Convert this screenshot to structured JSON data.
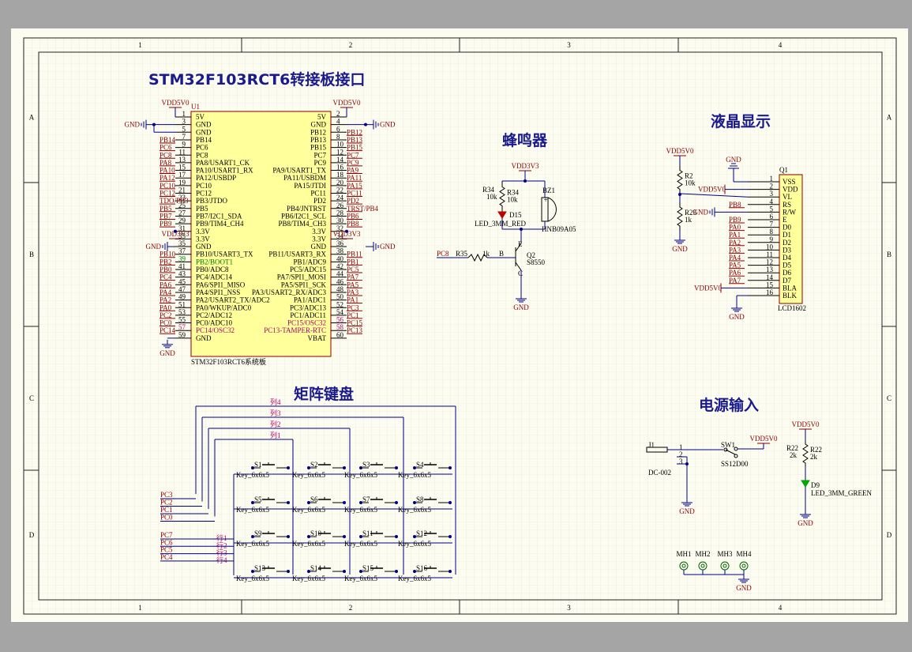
{
  "titles": {
    "mcu": "STM32F103RCT6转接板接口",
    "buzzer": "蜂鸣器",
    "lcd": "液晶显示",
    "keypad": "矩阵键盘",
    "power": "电源输入"
  },
  "zones": {
    "cols": [
      "1",
      "2",
      "3",
      "4"
    ],
    "rows": [
      "A",
      "B",
      "C",
      "D"
    ]
  },
  "mcu": {
    "ref": "U1",
    "footer": "STM32F103RCT6系统板",
    "left_pins": [
      {
        "num": "1",
        "name": "5V",
        "net": ""
      },
      {
        "num": "3",
        "name": "GND",
        "net": ""
      },
      {
        "num": "5",
        "name": "GND",
        "net": ""
      },
      {
        "num": "7",
        "name": "PB14",
        "net": "PB14"
      },
      {
        "num": "9",
        "name": "PC6",
        "net": "PC6"
      },
      {
        "num": "11",
        "name": "PC8",
        "net": "PC8"
      },
      {
        "num": "13",
        "name": "PA8/USART1_CK",
        "net": "PA8"
      },
      {
        "num": "15",
        "name": "PA10/USART1_RX",
        "net": "PA10"
      },
      {
        "num": "17",
        "name": "PA12/USBDP",
        "net": "PA12"
      },
      {
        "num": "19",
        "name": "PC10",
        "net": "PC10"
      },
      {
        "num": "21",
        "name": "PC12",
        "net": "PC12"
      },
      {
        "num": "23",
        "name": "PB3/JTDO",
        "net": "TDO/PB3"
      },
      {
        "num": "25",
        "name": "PB5",
        "net": "PB5"
      },
      {
        "num": "27",
        "name": "PB7/I2C1_SDA",
        "net": "PB7"
      },
      {
        "num": "29",
        "name": "PB9/TIM4_CH4",
        "net": "PB9"
      },
      {
        "num": "31",
        "name": "3.3V",
        "net": ""
      },
      {
        "num": "33",
        "name": "3.3V",
        "net": ""
      },
      {
        "num": "35",
        "name": "GND",
        "net": ""
      },
      {
        "num": "37",
        "name": "PB10/USART3_TX",
        "net": "PB10"
      },
      {
        "num": "39",
        "name": "PB2/BOOT1",
        "net": "PB2"
      },
      {
        "num": "41",
        "name": "PB0/ADC8",
        "net": "PB0"
      },
      {
        "num": "43",
        "name": "PC4/ADC14",
        "net": "PC4"
      },
      {
        "num": "45",
        "name": "PA6/SPI1_MISO",
        "net": "PA6"
      },
      {
        "num": "47",
        "name": "PA4/SPI1_NSS",
        "net": "PA4"
      },
      {
        "num": "49",
        "name": "PA2/USART2_TX/ADC2",
        "net": "PA2"
      },
      {
        "num": "51",
        "name": "PA0/WKUP/ADC0",
        "net": "PA0"
      },
      {
        "num": "53",
        "name": "PC2/ADC12",
        "net": "PC2"
      },
      {
        "num": "55",
        "name": "PC0/ADC10",
        "net": "PC0"
      },
      {
        "num": "57",
        "name": "PC14/OSC32",
        "net": "PC14"
      },
      {
        "num": "59",
        "name": "GND",
        "net": ""
      }
    ],
    "right_pins": [
      {
        "num": "2",
        "name": "5V",
        "net": ""
      },
      {
        "num": "4",
        "name": "GND",
        "net": ""
      },
      {
        "num": "6",
        "name": "PB12",
        "net": "PB12"
      },
      {
        "num": "8",
        "name": "PB13",
        "net": "PB13"
      },
      {
        "num": "10",
        "name": "PB15",
        "net": "PB15"
      },
      {
        "num": "12",
        "name": "PC7",
        "net": "PC7"
      },
      {
        "num": "14",
        "name": "PC9",
        "net": "PC9"
      },
      {
        "num": "16",
        "name": "PA9/USART1_TX",
        "net": "PA9"
      },
      {
        "num": "18",
        "name": "PA11/USBDM",
        "net": "PA11"
      },
      {
        "num": "20",
        "name": "PA15/JTDI",
        "net": "PA15"
      },
      {
        "num": "22",
        "name": "PC11",
        "net": "PC11"
      },
      {
        "num": "24",
        "name": "PD2",
        "net": "PD2"
      },
      {
        "num": "26",
        "name": "PB4/JNTRST",
        "net": "TRST/PB4"
      },
      {
        "num": "28",
        "name": "PB6/I2C1_SCL",
        "net": "PB6"
      },
      {
        "num": "30",
        "name": "PB8/TIM4_CH3",
        "net": "PB8"
      },
      {
        "num": "32",
        "name": "3.3V",
        "net": ""
      },
      {
        "num": "34",
        "name": "3.3V",
        "net": ""
      },
      {
        "num": "36",
        "name": "GND",
        "net": ""
      },
      {
        "num": "38",
        "name": "PB11/USART3_RX",
        "net": "PB11"
      },
      {
        "num": "40",
        "name": "PB1/ADC9",
        "net": "PB1"
      },
      {
        "num": "42",
        "name": "PC5/ADC15",
        "net": "PC5"
      },
      {
        "num": "44",
        "name": "PA7/SPI1_MOSI",
        "net": "PA7"
      },
      {
        "num": "46",
        "name": "PA5/SPI1_SCK",
        "net": "PA5"
      },
      {
        "num": "48",
        "name": "PA3/USART2_RX/ADC3",
        "net": "PA3"
      },
      {
        "num": "50",
        "name": "PA1/ADC1",
        "net": "PA1"
      },
      {
        "num": "52",
        "name": "PC3/ADC13",
        "net": "PC3"
      },
      {
        "num": "54",
        "name": "PC1/ADC11",
        "net": "PC1"
      },
      {
        "num": "56",
        "name": "PC15/OSC32",
        "net": "PC15"
      },
      {
        "num": "58",
        "name": "PC13-TAMPER-RTC",
        "net": "PC13"
      },
      {
        "num": "60",
        "name": "VBAT",
        "net": ""
      }
    ]
  },
  "power_nets": {
    "vdd5": "VDD5V0",
    "vdd3": "VDD3V3",
    "gnd": "GND"
  },
  "buzzer": {
    "r34": "R34",
    "r34_val": "10k",
    "d15": "D15",
    "d15_val": "LED_3MM_RED",
    "bz": "BZ1",
    "bz_val": "HNB09A05",
    "q": "Q2",
    "q_val": "S8550",
    "r35": "R35",
    "r35_val": "1k",
    "in_net": "PC8",
    "b": "B",
    "c": "C",
    "e": "E"
  },
  "lcd": {
    "ref": "Q1",
    "part": "LCD1602",
    "r2": "R2",
    "r2_val": "10k",
    "r23": "R23",
    "r23_val": "1k",
    "pins": [
      {
        "num": "1",
        "name": "VSS",
        "net": ""
      },
      {
        "num": "2",
        "name": "VDD",
        "net": ""
      },
      {
        "num": "3",
        "name": "VL",
        "net": ""
      },
      {
        "num": "4",
        "name": "RS",
        "net": "PB8"
      },
      {
        "num": "5",
        "name": "R/W",
        "net": ""
      },
      {
        "num": "6",
        "name": "E",
        "net": "PB9"
      },
      {
        "num": "7",
        "name": "D0",
        "net": "PA0"
      },
      {
        "num": "8",
        "name": "D1",
        "net": "PA1"
      },
      {
        "num": "9",
        "name": "D2",
        "net": "PA2"
      },
      {
        "num": "10",
        "name": "D3",
        "net": "PA3"
      },
      {
        "num": "11",
        "name": "D4",
        "net": "PA4"
      },
      {
        "num": "12",
        "name": "D5",
        "net": "PA5"
      },
      {
        "num": "13",
        "name": "D6",
        "net": "PA6"
      },
      {
        "num": "14",
        "name": "D7",
        "net": "PA7"
      },
      {
        "num": "15",
        "name": "BLA",
        "net": ""
      },
      {
        "num": "16",
        "name": "BLK",
        "net": ""
      }
    ]
  },
  "keypad": {
    "cols": [
      "列4",
      "列3",
      "列2",
      "列1"
    ],
    "rows": [
      "行1",
      "行2",
      "行3",
      "行4"
    ],
    "col_nets": [
      "PC3",
      "PC2",
      "PC1",
      "PC0"
    ],
    "row_nets": [
      "PC7",
      "PC6",
      "PC5",
      "PC4"
    ],
    "switches": [
      "S1",
      "S2",
      "S3",
      "S4",
      "S5",
      "S6",
      "S7",
      "S8",
      "S9",
      "S10",
      "S11",
      "S12",
      "S13",
      "S14",
      "S15",
      "S16"
    ],
    "value": "Key_6x6x5"
  },
  "power": {
    "j1": "J1",
    "j1_val": "DC-002",
    "sw": "SW1",
    "sw_val": "SS12D00",
    "r22": "R22",
    "r22_val": "2k",
    "d9": "D9",
    "d9_val": "LED_3MM_GREEN",
    "holes": [
      "MH1",
      "MH2",
      "MH3",
      "MH4"
    ]
  },
  "colors": {
    "sheet": "#fdfcf0",
    "wire": "#00008b",
    "chip": "#ffff9c",
    "net": "#8b0000",
    "title": "#1a1a8c",
    "grid": "#e2e1d3"
  }
}
